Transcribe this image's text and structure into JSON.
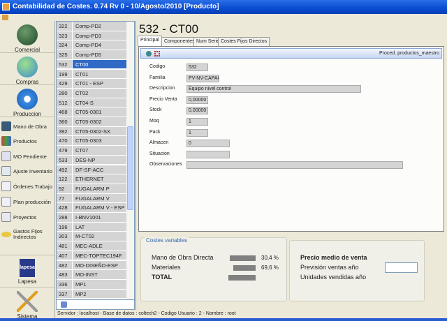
{
  "window": {
    "title": "Contabilidad de Costes. 0.74 Rv 0 - 10/Agosto/2010   [Producto]"
  },
  "nav": {
    "big": [
      {
        "label": "Comercial",
        "icon": "users-icon"
      },
      {
        "label": "Compras",
        "icon": "msn-users-icon"
      },
      {
        "label": "Produccion",
        "icon": "gear-icon"
      }
    ],
    "items": [
      {
        "label": "Mano de Obra"
      },
      {
        "label": "Productos"
      },
      {
        "label": "MO Pendiente"
      },
      {
        "label": "Ajuste Inventario"
      },
      {
        "label": "Órdenes Trabajo"
      },
      {
        "label": "Plan producción"
      },
      {
        "label": "Proyectos"
      },
      {
        "label": "Gastos Fijos Indirectos"
      }
    ],
    "bottom": [
      {
        "label": "Lapesa",
        "logo": "lapesa"
      },
      {
        "label": "Sistema",
        "icon": "tools-icon"
      }
    ]
  },
  "list": {
    "selected_index": 4,
    "rows": [
      [
        "322",
        "Comp-PD2"
      ],
      [
        "323",
        "Comp-PD3"
      ],
      [
        "324",
        "Comp-PD4"
      ],
      [
        "325",
        "Comp-PD5"
      ],
      [
        "532",
        "CT00"
      ],
      [
        "199",
        "CT01"
      ],
      [
        "429",
        "CT01 - ESP"
      ],
      [
        "280",
        "CT02"
      ],
      [
        "512",
        "CT04-S"
      ],
      [
        "468",
        "CT05-0301"
      ],
      [
        "360",
        "CT05-0302"
      ],
      [
        "392",
        "CT05-0302-SX"
      ],
      [
        "470",
        "CT05-0303"
      ],
      [
        "479",
        "CT07"
      ],
      [
        "533",
        "DES-NP"
      ],
      [
        "492",
        "DF-SF-ACC"
      ],
      [
        "122",
        "ETHERNET"
      ],
      [
        "92",
        "FUGALARM P"
      ],
      [
        "77",
        "FUGALARM V"
      ],
      [
        "428",
        "FUGALARM V - ESP"
      ],
      [
        "288",
        "I-BNV1001"
      ],
      [
        "196",
        "LAT"
      ],
      [
        "303",
        "M-CT02"
      ],
      [
        "481",
        "MEC-ADLE"
      ],
      [
        "407",
        "MEC-TOPTEC194F"
      ],
      [
        "482",
        "MO-DISEÑO-ESP"
      ],
      [
        "483",
        "MO-INST"
      ],
      [
        "336",
        "MP1"
      ],
      [
        "337",
        "MP2"
      ]
    ]
  },
  "status": "Servidor : localhost - Base de datos : coltech2 -   Codigo Usuario : 2 - Nombre : root",
  "main": {
    "title": "532 - CT00",
    "tabs": [
      "Principal",
      "Componentes",
      "Num Serie",
      "Costes Fijos Directos"
    ],
    "active_tab": 0,
    "header_text": "Proced. productos_maestro",
    "fields": [
      {
        "label": "Codigo",
        "value": "532"
      },
      {
        "label": "Familia",
        "value": "PV-NV-CAPACITIV"
      },
      {
        "label": "Descripcion",
        "value": "Equipo nivel control"
      },
      {
        "label": "Precio Venta",
        "value": "0,00000"
      },
      {
        "label": "Stock",
        "value": "0,00000"
      },
      {
        "label": "Moq",
        "value": "1"
      },
      {
        "label": "Pack",
        "value": "1"
      },
      {
        "label": "Almacen",
        "value": "0"
      },
      {
        "label": "Situacion",
        "value": ""
      },
      {
        "label": "Observaciones",
        "value": ""
      }
    ],
    "costes": {
      "title": "Costes variables",
      "mano_obra_label": "Mano de Obra Directa",
      "mano_obra_pct": "30,4 %",
      "materiales_label": "Materiales",
      "materiales_pct": "69,6 %",
      "total_label": "TOTAL"
    },
    "precio": {
      "title": "Precio medio de venta",
      "prevision_label": "Previsión ventas año",
      "prevision_value": "",
      "unidades_label": "Unidades vendidas año"
    }
  }
}
